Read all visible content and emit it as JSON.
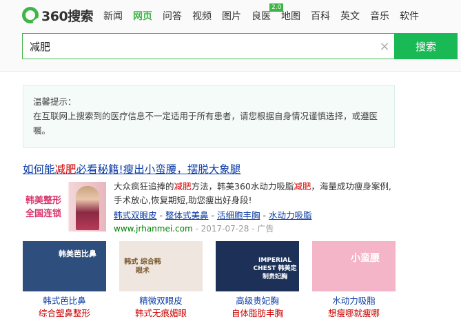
{
  "logo": {
    "text": "360搜索"
  },
  "nav": {
    "items": [
      {
        "label": "新闻",
        "active": false
      },
      {
        "label": "网页",
        "active": true
      },
      {
        "label": "问答",
        "active": false
      },
      {
        "label": "视频",
        "active": false
      },
      {
        "label": "图片",
        "active": false
      },
      {
        "label": "良医",
        "active": false,
        "badge": "2.0"
      },
      {
        "label": "地图",
        "active": false
      },
      {
        "label": "百科",
        "active": false
      },
      {
        "label": "英文",
        "active": false
      },
      {
        "label": "音乐",
        "active": false
      },
      {
        "label": "软件",
        "active": false
      }
    ]
  },
  "search": {
    "query": "减肥",
    "clear_symbol": "×",
    "button_label": "搜索"
  },
  "notice": {
    "title": "温馨提示：",
    "body": "在互联网上搜索到的医疗信息不一定适用于所有患者，请您根据自身情况谨慎选择，或遵医嘱。"
  },
  "result": {
    "title_pre": "如何能",
    "title_hl": "减肥",
    "title_post": "必看秘籍!瘦出小蛮腰，摆脱大象腿",
    "ad_brand_line1": "韩美整形",
    "ad_brand_line2": "全国连锁",
    "desc_1": "大众疯狂追捧的",
    "desc_hl1": "减肥",
    "desc_2": "方法，韩美360水动力吸脂",
    "desc_hl2": "减肥",
    "desc_3": "，海量成功瘦身案例,手术放心,恢复期短,助您瘦出好身段!",
    "links": [
      "韩式双眼皮",
      "整体式美鼻",
      "活细胞丰胸",
      "水动力吸脂"
    ],
    "link_sep": " - ",
    "url": "www.jrhanmei.com",
    "date": "2017-07-28",
    "ad_label": "广告",
    "meta_sep": " - "
  },
  "gallery": [
    {
      "title": "韩式芭比鼻",
      "subtitle": "综合塑鼻整形",
      "caption": "韩美芭比鼻",
      "bg": "#2e4f7e"
    },
    {
      "title": "精微双眼皮",
      "subtitle": "韩式无痕媚眼",
      "caption": "韩式 综合韩眼术",
      "bg": "#efe6df"
    },
    {
      "title": "高级贵妃胸",
      "subtitle": "自体脂肪丰胸",
      "caption": "IMPERIAL CHEST 韩美定制贵妃胸",
      "bg": "#1d3158"
    },
    {
      "title": "水动力吸脂",
      "subtitle": "想瘦哪就瘦哪",
      "caption": "小蛮腰",
      "bg": "#f4b5c9"
    }
  ],
  "colors": {
    "accent": "#3fb547",
    "button": "#19b955",
    "link": "#0b3ca4",
    "highlight": "#cc0000",
    "url": "#008000"
  }
}
